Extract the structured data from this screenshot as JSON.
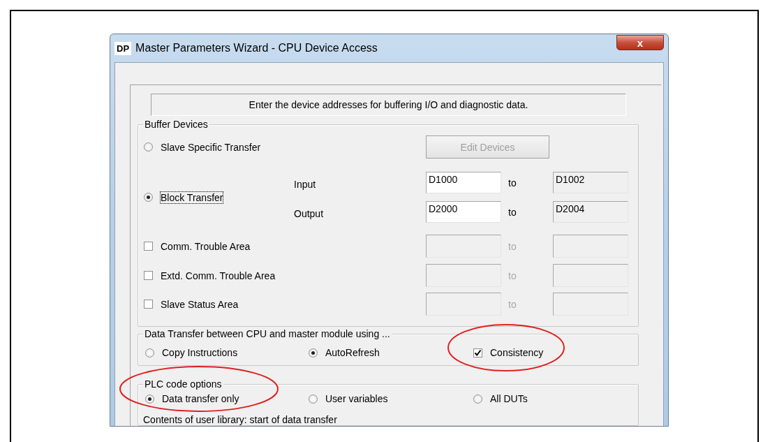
{
  "window": {
    "icon_text": "DP",
    "title": "Master Parameters Wizard - CPU Device Access",
    "close": "x"
  },
  "header": "Enter the device addresses for buffering I/O and diagnostic data.",
  "buffer_devices": {
    "title": "Buffer Devices",
    "slave_specific": {
      "label": "Slave Specific Transfer",
      "selected": false
    },
    "edit_button": {
      "label": "Edit Devices",
      "disabled": true
    },
    "block_transfer": {
      "label": "Block Transfer",
      "selected": true,
      "focused": true
    },
    "ranges": [
      {
        "label": "Input",
        "from": "D1000",
        "to_label": "to",
        "to": "D1002"
      },
      {
        "label": "Output",
        "from": "D2000",
        "to_label": "to",
        "to": "D2004"
      }
    ],
    "areas": [
      {
        "label": "Comm. Trouble Area",
        "checked": false,
        "disabled": true,
        "to_label": "to"
      },
      {
        "label": "Extd. Comm. Trouble Area",
        "checked": false,
        "disabled": true,
        "to_label": "to"
      },
      {
        "label": "Slave Status Area",
        "checked": false,
        "disabled": true,
        "to_label": "to"
      }
    ]
  },
  "data_transfer": {
    "title": "Data Transfer between CPU and master module using ...",
    "options": [
      {
        "kind": "radio",
        "label": "Copy Instructions",
        "selected": false,
        "circled": false
      },
      {
        "kind": "radio",
        "label": "AutoRefresh",
        "selected": true,
        "circled": false
      },
      {
        "kind": "checkbox",
        "label": "Consistency",
        "checked": true,
        "circled": true
      }
    ]
  },
  "plc_code": {
    "title": "PLC code options",
    "options": [
      {
        "kind": "radio",
        "label": "Data transfer only",
        "selected": true,
        "circled": true
      },
      {
        "kind": "radio",
        "label": "User variables",
        "selected": false,
        "circled": false
      },
      {
        "kind": "radio",
        "label": "All DUTs",
        "selected": false,
        "circled": false
      }
    ],
    "note": "Contents of user library: start of data transfer"
  }
}
